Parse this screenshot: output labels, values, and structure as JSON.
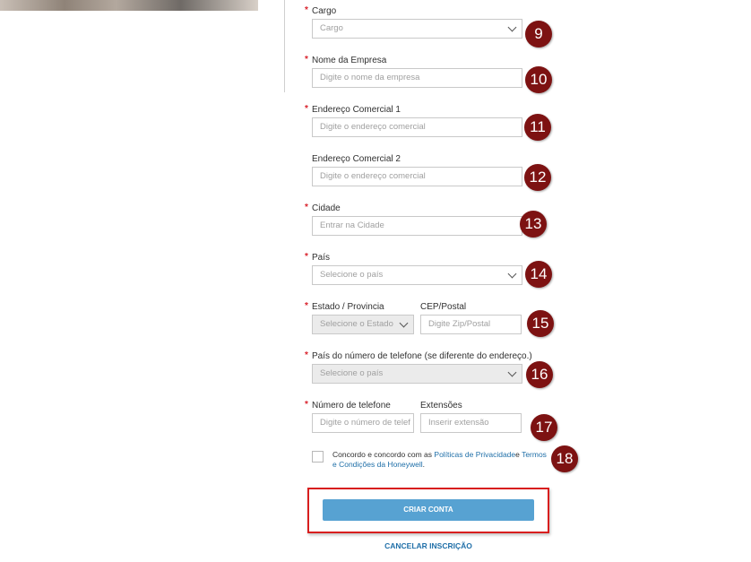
{
  "form": {
    "cargo": {
      "label": "Cargo",
      "value": "Cargo",
      "badge": "9"
    },
    "empresa": {
      "label": "Nome da Empresa",
      "placeholder": "Digite o nome da empresa",
      "badge": "10"
    },
    "endereco1": {
      "label": "Endereço Comercial 1",
      "placeholder": "Digite o endereço comercial",
      "badge": "11"
    },
    "endereco2": {
      "label": "Endereço Comercial 2",
      "placeholder": "Digite o endereço comercial",
      "badge": "12"
    },
    "cidade": {
      "label": "Cidade",
      "placeholder": "Entrar na Cidade",
      "badge": "13"
    },
    "pais": {
      "label": "País",
      "value": "Selecione o país",
      "badge": "14"
    },
    "estado": {
      "label": "Estado / Provincia",
      "value": "Selecione o Estado"
    },
    "cep": {
      "label": "CEP/Postal",
      "placeholder": "Digite Zip/Postal",
      "badge": "15"
    },
    "pais_telefone": {
      "label": "País do número de telefone (se diferente do endereço.)",
      "value": "Selecione o país",
      "badge": "16"
    },
    "telefone": {
      "label": "Número de telefone",
      "placeholder": "Digite o número de telef"
    },
    "extensoes": {
      "label": "Extensões",
      "placeholder": "Inserir extensão",
      "badge": "17"
    },
    "required_marker": "*"
  },
  "consent": {
    "text_before": "Concordo e concordo com as ",
    "link_privacy": "Políticas de Privacidade",
    "text_middle": "e ",
    "link_terms": "Termos e Condições da Honeywell",
    "text_after": ".",
    "badge": "18"
  },
  "actions": {
    "create_label": "CRIAR CONTA",
    "cancel_label": "CANCELAR INSCRIÇÃO"
  },
  "colors": {
    "required": "#d9232d",
    "badge": "#7d1212",
    "primary_button": "#57a2d2",
    "link": "#1f6fa8",
    "highlight": "#d81e1e"
  }
}
